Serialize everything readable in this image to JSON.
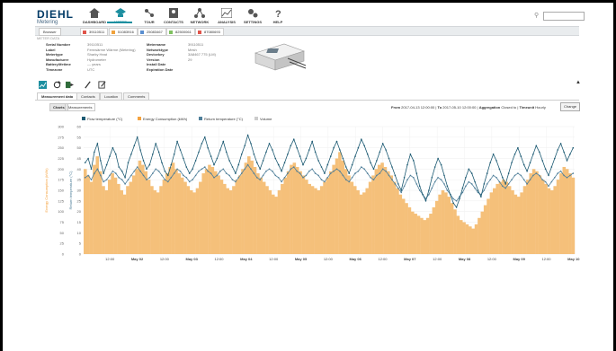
{
  "brand": {
    "name": "DIEHL",
    "sub": "Metering"
  },
  "nav": [
    {
      "label": "DASHBOARD",
      "icon": "home-icon",
      "active": false
    },
    {
      "label": "METER",
      "icon": "meter-icon",
      "active": true
    },
    {
      "label": "TOUR",
      "icon": "tour-icon",
      "active": false
    },
    {
      "label": "CONTACTS",
      "icon": "contacts-icon",
      "active": false
    },
    {
      "label": "NETWORK",
      "icon": "network-icon",
      "active": false
    },
    {
      "label": "ANALYSIS",
      "icon": "analysis-icon",
      "active": false
    },
    {
      "label": "SETTINGS",
      "icon": "settings-icon",
      "active": false
    },
    {
      "label": "HELP",
      "icon": "help-icon",
      "active": false
    }
  ],
  "browser_label": "Browser",
  "tabs": [
    {
      "label": "39110511",
      "color": "#e0544a"
    },
    {
      "label": "51083916",
      "color": "#f0a23c"
    },
    {
      "label": "25083467",
      "color": "#5a8fd0"
    },
    {
      "label": "82500061",
      "color": "#7fc160"
    },
    {
      "label": "87080693",
      "color": "#e0544a"
    }
  ],
  "section_label": "METER DATA",
  "meter_left": [
    {
      "k": "Serial Number",
      "v": "39110511"
    },
    {
      "k": "Label",
      "v": "Fernwärme Wärme (Metering)"
    },
    {
      "k": "Metertype",
      "v": "Sharky Heat"
    },
    {
      "k": "Manufacturer",
      "v": "Hydrometer"
    },
    {
      "k": "Batterylifetime",
      "v": "— years"
    },
    {
      "k": "Timezone",
      "v": "UTC"
    }
  ],
  "meter_right": [
    {
      "k": "Metername",
      "v": "39110511"
    },
    {
      "k": "Networktype",
      "v": "Mesh"
    },
    {
      "k": "Devicekey",
      "v": "3A8467 775 (LM)"
    },
    {
      "k": "Version",
      "v": "29"
    },
    {
      "k": "Install Date",
      "v": ""
    },
    {
      "k": "Expiration Date",
      "v": ""
    }
  ],
  "subtabs": [
    "Measurement data",
    "Contacts",
    "Location",
    "Comments"
  ],
  "view_toggle": [
    "Charts",
    "Measurements"
  ],
  "range": {
    "from_label": "From",
    "from": "2017-04-13 12:00:00",
    "to_label": "To",
    "to": "2017-05-10 12:00:00",
    "agg_label": "Aggregation",
    "agg": "Closed to",
    "tz_label": "Timeunit",
    "tz": "Hourly"
  },
  "change_label": "Change",
  "colors": {
    "accent": "#1d8fa0",
    "flow": "#1c5a73",
    "return": "#4f7f9a",
    "energy": "#f5c07a"
  },
  "chart_data": {
    "type": "line",
    "legend": [
      {
        "name": "Flow temperature (°C)",
        "color": "#1c5a73"
      },
      {
        "name": "Energy Consumption (kWh)",
        "color": "#f5a340"
      },
      {
        "name": "Return temperature (°C)",
        "color": "#4f7f9a"
      },
      {
        "name": "Volume",
        "color": "#cccccc"
      }
    ],
    "ylabel_left": "Energy Consumption (kWh)",
    "ylabel_right": "Return temperature (°C)",
    "y_left_ticks": [
      0,
      25,
      50,
      75,
      100,
      125,
      150,
      175,
      200,
      225,
      250,
      275,
      300
    ],
    "y_right_ticks": [
      0,
      5,
      10,
      15,
      20,
      25,
      30,
      35,
      40,
      45,
      50,
      55,
      60
    ],
    "x_ticks": [
      "12:00",
      "May 02",
      "12:00",
      "May 03",
      "12:00",
      "May 04",
      "12:00",
      "May 05",
      "12:00",
      "May 06",
      "12:00",
      "May 07",
      "12:00",
      "May 08",
      "12:00",
      "May 09",
      "12:00",
      "May 10"
    ],
    "ylim_left": [
      0,
      300
    ],
    "ylim_right": [
      0,
      60
    ],
    "energy": [
      200,
      185,
      170,
      210,
      230,
      195,
      160,
      150,
      175,
      190,
      180,
      165,
      150,
      140,
      160,
      170,
      185,
      200,
      220,
      210,
      195,
      175,
      160,
      150,
      145,
      160,
      175,
      190,
      205,
      215,
      200,
      190,
      180,
      170,
      160,
      150,
      145,
      155,
      170,
      190,
      200,
      210,
      205,
      195,
      185,
      175,
      165,
      155,
      150,
      160,
      175,
      185,
      200,
      215,
      230,
      220,
      205,
      190,
      180,
      170,
      160,
      150,
      140,
      135,
      150,
      165,
      180,
      195,
      210,
      215,
      205,
      195,
      185,
      175,
      165,
      160,
      155,
      150,
      160,
      170,
      180,
      195,
      210,
      225,
      240,
      220,
      200,
      185,
      170,
      160,
      150,
      140,
      145,
      155,
      170,
      185,
      200,
      210,
      215,
      205,
      195,
      185,
      170,
      155,
      140,
      130,
      120,
      110,
      100,
      95,
      90,
      85,
      80,
      85,
      95,
      110,
      125,
      140,
      150,
      145,
      135,
      120,
      105,
      90,
      80,
      75,
      70,
      65,
      60,
      70,
      85,
      100,
      115,
      130,
      145,
      155,
      165,
      170,
      175,
      170,
      160,
      150,
      140,
      135,
      145,
      160,
      175,
      190,
      200,
      195,
      185,
      175,
      165,
      155,
      150,
      160,
      175,
      190,
      205,
      200,
      190,
      180
    ],
    "flow_temp": [
      43,
      45,
      40,
      48,
      52,
      44,
      38,
      42,
      46,
      50,
      47,
      41,
      39,
      36,
      43,
      47,
      51,
      55,
      49,
      44,
      40,
      42,
      47,
      52,
      48,
      43,
      39,
      37,
      42,
      47,
      53,
      49,
      45,
      41,
      38,
      40,
      44,
      48,
      52,
      55,
      50,
      46,
      42,
      45,
      49,
      53,
      48,
      44,
      41,
      38,
      42,
      47,
      51,
      56,
      52,
      47,
      43,
      40,
      44,
      48,
      52,
      49,
      45,
      42,
      39,
      43,
      47,
      51,
      54,
      50,
      46,
      42,
      45,
      49,
      53,
      48,
      44,
      41,
      38,
      42,
      46,
      50,
      53,
      49,
      45,
      41,
      38,
      42,
      46,
      50,
      54,
      51,
      47,
      43,
      40,
      44,
      48,
      52,
      49,
      45,
      41,
      37,
      33,
      30,
      36,
      42,
      47,
      44,
      38,
      32,
      28,
      25,
      30,
      36,
      41,
      45,
      42,
      37,
      32,
      28,
      24,
      22,
      26,
      31,
      36,
      40,
      38,
      34,
      30,
      27,
      33,
      38,
      43,
      47,
      44,
      40,
      36,
      33,
      38,
      43,
      47,
      50,
      46,
      42,
      39,
      43,
      47,
      51,
      48,
      44,
      40,
      37,
      41,
      45,
      49,
      52,
      48,
      44,
      47,
      50
    ],
    "return_temp": [
      36,
      37,
      35,
      38,
      40,
      37,
      34,
      35,
      37,
      39,
      38,
      36,
      35,
      33,
      35,
      37,
      39,
      41,
      39,
      37,
      35,
      36,
      38,
      40,
      39,
      37,
      35,
      34,
      36,
      38,
      40,
      39,
      37,
      36,
      34,
      35,
      37,
      39,
      40,
      41,
      39,
      38,
      36,
      37,
      39,
      40,
      38,
      37,
      35,
      34,
      36,
      38,
      40,
      42,
      40,
      38,
      36,
      35,
      37,
      39,
      40,
      39,
      37,
      36,
      34,
      36,
      38,
      40,
      41,
      39,
      38,
      36,
      37,
      39,
      40,
      38,
      37,
      35,
      34,
      36,
      38,
      39,
      40,
      39,
      37,
      35,
      34,
      36,
      38,
      39,
      41,
      40,
      38,
      36,
      35,
      37,
      38,
      40,
      39,
      37,
      35,
      33,
      31,
      29,
      32,
      35,
      37,
      36,
      33,
      30,
      28,
      26,
      28,
      31,
      34,
      36,
      35,
      33,
      30,
      28,
      26,
      25,
      27,
      29,
      32,
      34,
      33,
      31,
      29,
      28,
      30,
      33,
      35,
      37,
      36,
      34,
      32,
      31,
      33,
      35,
      37,
      38,
      37,
      35,
      33,
      35,
      37,
      38,
      37,
      35,
      34,
      32,
      34,
      36,
      38,
      39,
      37,
      36,
      37,
      38
    ]
  }
}
